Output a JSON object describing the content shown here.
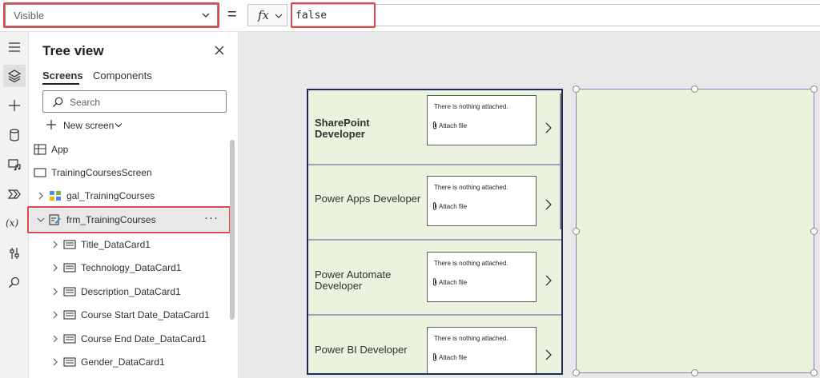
{
  "formula_bar": {
    "property": "Visible",
    "equals": "=",
    "fx_label": "fx",
    "formula": "false"
  },
  "rail": {
    "icons": [
      "hamburger-icon",
      "layers-icon",
      "plus-icon",
      "database-icon",
      "media-icon",
      "flow-icon",
      "variables-icon",
      "tools-icon",
      "search-icon"
    ],
    "variables_label": "(x)"
  },
  "tree_view": {
    "title": "Tree view",
    "tabs": [
      {
        "label": "Screens",
        "selected": true
      },
      {
        "label": "Components",
        "selected": false
      }
    ],
    "search_placeholder": "Search",
    "new_screen_label": "New screen",
    "nodes": [
      {
        "label": "App",
        "type": "app",
        "level": 0,
        "expander": "none"
      },
      {
        "label": "TrainingCoursesScreen",
        "type": "screen",
        "level": 0,
        "expander": "none"
      },
      {
        "label": "gal_TrainingCourses",
        "type": "gallery",
        "level": 1,
        "expander": "collapsed"
      },
      {
        "label": "frm_TrainingCourses",
        "type": "form",
        "level": 1,
        "expander": "expanded",
        "selected": true
      },
      {
        "label": "Title_DataCard1",
        "type": "card",
        "level": 2,
        "expander": "collapsed"
      },
      {
        "label": "Technology_DataCard1",
        "type": "card",
        "level": 2,
        "expander": "collapsed"
      },
      {
        "label": "Description_DataCard1",
        "type": "card",
        "level": 2,
        "expander": "collapsed"
      },
      {
        "label": "Course Start Date_DataCard1",
        "type": "card",
        "level": 2,
        "expander": "collapsed"
      },
      {
        "label": "Course End Date_DataCard1",
        "type": "card",
        "level": 2,
        "expander": "collapsed"
      },
      {
        "label": "Gender_DataCard1",
        "type": "card",
        "level": 2,
        "expander": "collapsed"
      }
    ],
    "more_label": "···"
  },
  "gallery": {
    "rows": [
      {
        "title": "SharePoint Developer",
        "bold": true,
        "nothing_attached": "There is nothing attached.",
        "attach_label": "Attach file"
      },
      {
        "title": "Power Apps Developer",
        "bold": false,
        "nothing_attached": "There is nothing attached.",
        "attach_label": "Attach file"
      },
      {
        "title": "Power Automate Developer",
        "bold": false,
        "nothing_attached": "There is nothing attached.",
        "attach_label": "Attach file"
      },
      {
        "title": "Power BI Developer",
        "bold": false,
        "nothing_attached": "There is nothing attached.",
        "attach_label": "Attach file"
      }
    ]
  },
  "colors": {
    "highlight_box": "#e04848",
    "gallery_border": "#1b2a59",
    "gallery_bg": "#ebf3de",
    "form_bg": "#e9f3dc",
    "canvas_bg": "#e8e8e8"
  }
}
